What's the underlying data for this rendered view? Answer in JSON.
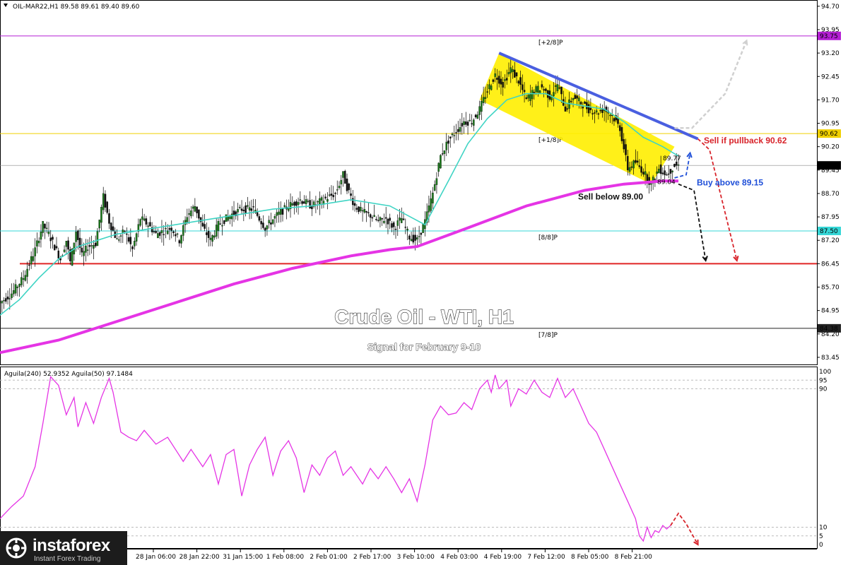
{
  "header": {
    "symbol_line": "OIL-MAR22,H1  89.58 89.61 89.40 89.60",
    "indicator_line": "Aguila(240) 52.9352  Aguila(50) 97.1484"
  },
  "overlay": {
    "title": "Crude Oil - WTI, H1",
    "subtitle": "Signal for February 9-10"
  },
  "logo": {
    "name": "instaforex",
    "tagline": "Instant Forex Trading",
    "icon": "instaforex-logo-icon"
  },
  "colors": {
    "ma200": "#e534e5",
    "ma21": "#3fd4c4",
    "channel": "#ffee00",
    "trendline": "#4a5fe0",
    "support_line": "#e02525",
    "murray_top": "#b41fd4",
    "murray_yellow": "#f0d000",
    "murray_cyan": "#35d7d7",
    "bull": "#1a7a1a",
    "bear": "#111111",
    "sell_annotation": "#d8232a",
    "buy_annotation": "#1f4fd8",
    "oscillator": "#e534e5"
  },
  "chart_data": [
    {
      "type": "candlestick",
      "title": "Crude Oil - WTI, H1",
      "x_tick_labels": [
        "28 Jan 06:00",
        "28 Jan 22:00",
        "31 Jan 15:00",
        "1 Feb 08:00",
        "2 Feb 01:00",
        "2 Feb 17:00",
        "3 Feb 10:00",
        "4 Feb 03:00",
        "4 Feb 19:00",
        "7 Feb 12:00",
        "8 Feb 05:00",
        "8 Feb 21:00"
      ],
      "y_tick_labels": [
        "94.70",
        "93.95",
        "93.20",
        "92.45",
        "91.70",
        "90.95",
        "90.20",
        "89.45",
        "88.70",
        "87.95",
        "87.20",
        "86.45",
        "85.70",
        "84.95",
        "84.20",
        "83.45"
      ],
      "ylim": [
        83.2,
        94.9
      ],
      "close_path": [
        [
          0,
          85.2
        ],
        [
          6,
          85.5
        ],
        [
          12,
          86.0
        ],
        [
          18,
          86.9
        ],
        [
          22,
          87.7
        ],
        [
          25,
          87.4
        ],
        [
          28,
          87.0
        ],
        [
          31,
          86.6
        ],
        [
          34,
          87.2
        ],
        [
          36,
          86.5
        ],
        [
          39,
          87.5
        ],
        [
          42,
          86.7
        ],
        [
          45,
          87.0
        ],
        [
          49,
          87.1
        ],
        [
          53,
          88.6
        ],
        [
          56,
          87.8
        ],
        [
          60,
          87.2
        ],
        [
          64,
          87.5
        ],
        [
          68,
          86.9
        ],
        [
          72,
          87.9
        ],
        [
          76,
          87.7
        ],
        [
          80,
          87.4
        ],
        [
          84,
          87.5
        ],
        [
          88,
          87.6
        ],
        [
          92,
          87.2
        ],
        [
          96,
          88.0
        ],
        [
          100,
          88.3
        ],
        [
          104,
          87.6
        ],
        [
          108,
          87.2
        ],
        [
          112,
          87.7
        ],
        [
          118,
          88.0
        ],
        [
          124,
          88.2
        ],
        [
          130,
          88.2
        ],
        [
          136,
          87.6
        ],
        [
          142,
          88.0
        ],
        [
          148,
          88.3
        ],
        [
          154,
          88.5
        ],
        [
          160,
          88.3
        ],
        [
          166,
          88.5
        ],
        [
          172,
          88.7
        ],
        [
          176,
          89.3
        ],
        [
          178,
          88.9
        ],
        [
          182,
          88.3
        ],
        [
          186,
          88.1
        ],
        [
          190,
          88.0
        ],
        [
          194,
          87.8
        ],
        [
          198,
          87.9
        ],
        [
          202,
          87.6
        ],
        [
          206,
          87.9
        ],
        [
          210,
          87.3
        ],
        [
          214,
          87.2
        ],
        [
          218,
          87.8
        ],
        [
          222,
          88.7
        ],
        [
          226,
          89.9
        ],
        [
          230,
          90.4
        ],
        [
          234,
          90.7
        ],
        [
          238,
          91.0
        ],
        [
          242,
          91.0
        ],
        [
          246,
          91.4
        ],
        [
          250,
          92.0
        ],
        [
          254,
          92.5
        ],
        [
          258,
          92.2
        ],
        [
          262,
          92.7
        ],
        [
          266,
          92.3
        ],
        [
          270,
          91.7
        ],
        [
          274,
          92.0
        ],
        [
          278,
          92.1
        ],
        [
          282,
          91.8
        ],
        [
          286,
          92.2
        ],
        [
          290,
          91.4
        ],
        [
          294,
          91.8
        ],
        [
          298,
          91.6
        ],
        [
          302,
          91.4
        ],
        [
          306,
          91.3
        ],
        [
          310,
          91.4
        ],
        [
          314,
          91.2
        ],
        [
          318,
          90.8
        ],
        [
          322,
          89.5
        ],
        [
          326,
          89.7
        ],
        [
          330,
          89.4
        ],
        [
          334,
          89.0
        ],
        [
          338,
          89.5
        ],
        [
          342,
          89.3
        ],
        [
          346,
          89.6
        ],
        [
          348,
          89.6
        ]
      ],
      "ma21_path": [
        [
          0,
          84.8
        ],
        [
          10,
          85.3
        ],
        [
          20,
          86.0
        ],
        [
          30,
          86.6
        ],
        [
          40,
          87.0
        ],
        [
          60,
          87.4
        ],
        [
          80,
          87.6
        ],
        [
          100,
          87.8
        ],
        [
          120,
          88.0
        ],
        [
          140,
          88.2
        ],
        [
          160,
          88.3
        ],
        [
          180,
          88.5
        ],
        [
          200,
          88.3
        ],
        [
          212,
          87.9
        ],
        [
          218,
          87.7
        ],
        [
          230,
          89.1
        ],
        [
          240,
          90.3
        ],
        [
          250,
          91.1
        ],
        [
          260,
          91.7
        ],
        [
          270,
          91.9
        ],
        [
          280,
          91.9
        ],
        [
          290,
          91.6
        ],
        [
          300,
          91.5
        ],
        [
          310,
          91.4
        ],
        [
          320,
          91.0
        ],
        [
          330,
          90.5
        ],
        [
          340,
          90.2
        ],
        [
          348,
          89.9
        ]
      ],
      "ma200_path": [
        [
          0,
          83.6
        ],
        [
          30,
          84.0
        ],
        [
          60,
          84.6
        ],
        [
          90,
          85.2
        ],
        [
          120,
          85.8
        ],
        [
          150,
          86.3
        ],
        [
          180,
          86.7
        ],
        [
          200,
          86.9
        ],
        [
          214,
          87.0
        ],
        [
          240,
          87.6
        ],
        [
          270,
          88.3
        ],
        [
          300,
          88.8
        ],
        [
          320,
          89.0
        ],
        [
          340,
          89.1
        ],
        [
          348,
          89.1
        ]
      ],
      "horizontal_lines": [
        {
          "label": "[+2/8]P",
          "price": 93.75,
          "axis_label": "93.75"
        },
        {
          "label": "[+1/8]P",
          "price": 90.62,
          "axis_label": "90.62"
        },
        {
          "label": "[8/8]P",
          "price": 87.5,
          "axis_label": "87.50"
        },
        {
          "label": "[7/8]P",
          "price": 84.38,
          "axis_label": "84.38"
        },
        {
          "label": "",
          "price": 86.45,
          "axis_label": ""
        }
      ],
      "current_price": {
        "price": 89.6,
        "axis_label": "89.60"
      },
      "channel": {
        "upper": [
          [
            256,
            93.2
          ],
          [
            346,
            90.2
          ]
        ],
        "lower": [
          [
            246,
            91.7
          ],
          [
            334,
            89.0
          ]
        ]
      },
      "trendline": [
        [
          256,
          93.2
        ],
        [
          358,
          90.45
        ]
      ],
      "annotations": [
        {
          "text": "Sell if pullback 90.62",
          "price": 90.4,
          "role": "sell"
        },
        {
          "text": "Buy above 89.15",
          "price": 89.05,
          "role": "buy"
        },
        {
          "text": "Sell below 89.00",
          "price": 88.6,
          "role": "sell-below"
        },
        {
          "text": "89.77",
          "price": 89.85,
          "role": "level"
        },
        {
          "text": "89.04",
          "price": 89.1,
          "role": "level"
        }
      ],
      "projections": [
        {
          "role": "bullish",
          "color": "#d0d0d0",
          "points": [
            [
              346,
              90.8
            ],
            [
              355,
              90.8
            ],
            [
              372,
              91.9
            ],
            [
              383,
              93.6
            ]
          ]
        },
        {
          "role": "bearish-red",
          "color": "#d8232a",
          "points": [
            [
              358,
              90.45
            ],
            [
              364,
              90.1
            ],
            [
              378,
              86.55
            ]
          ]
        },
        {
          "role": "bearish-black",
          "color": "#111111",
          "points": [
            [
              348,
              89.0
            ],
            [
              356,
              88.8
            ],
            [
              362,
              86.55
            ]
          ]
        },
        {
          "role": "buy-up",
          "color": "#1f4fd8",
          "points": [
            [
              346,
              89.2
            ],
            [
              352,
              89.3
            ],
            [
              354,
              90.0
            ]
          ]
        }
      ]
    },
    {
      "type": "line",
      "title": "Aguila(240) 52.9352  Aguila(50) 97.1484",
      "ylim": [
        0,
        100
      ],
      "y_tick_labels": [
        "100",
        "95",
        "90",
        "10",
        "5",
        "0"
      ],
      "levels": [
        95,
        90,
        10,
        5
      ],
      "series": [
        {
          "name": "",
          "points": [
            [
              0,
              15
            ],
            [
              6,
              22
            ],
            [
              12,
              28
            ],
            [
              18,
              45
            ],
            [
              22,
              70
            ],
            [
              26,
              97
            ],
            [
              30,
              92
            ],
            [
              34,
              75
            ],
            [
              38,
              85
            ],
            [
              40,
              68
            ],
            [
              44,
              82
            ],
            [
              48,
              70
            ],
            [
              52,
              85
            ],
            [
              56,
              96
            ],
            [
              58,
              88
            ],
            [
              62,
              65
            ],
            [
              66,
              62
            ],
            [
              70,
              60
            ],
            [
              74,
              66
            ],
            [
              80,
              58
            ],
            [
              86,
              62
            ],
            [
              90,
              55
            ],
            [
              94,
              48
            ],
            [
              98,
              55
            ],
            [
              104,
              45
            ],
            [
              108,
              52
            ],
            [
              112,
              35
            ],
            [
              116,
              52
            ],
            [
              120,
              55
            ],
            [
              124,
              28
            ],
            [
              128,
              46
            ],
            [
              132,
              55
            ],
            [
              136,
              62
            ],
            [
              140,
              40
            ],
            [
              144,
              54
            ],
            [
              148,
              60
            ],
            [
              152,
              50
            ],
            [
              156,
              30
            ],
            [
              160,
              46
            ],
            [
              164,
              40
            ],
            [
              168,
              50
            ],
            [
              172,
              54
            ],
            [
              176,
              40
            ],
            [
              180,
              45
            ],
            [
              186,
              35
            ],
            [
              190,
              44
            ],
            [
              194,
              38
            ],
            [
              198,
              45
            ],
            [
              202,
              38
            ],
            [
              206,
              30
            ],
            [
              210,
              38
            ],
            [
              214,
              25
            ],
            [
              218,
              46
            ],
            [
              222,
              72
            ],
            [
              226,
              80
            ],
            [
              230,
              75
            ],
            [
              234,
              76
            ],
            [
              238,
              82
            ],
            [
              242,
              78
            ],
            [
              246,
              90
            ],
            [
              250,
              95
            ],
            [
              252,
              88
            ],
            [
              254,
              98
            ],
            [
              256,
              90
            ],
            [
              260,
              95
            ],
            [
              262,
              80
            ],
            [
              266,
              90
            ],
            [
              270,
              87
            ],
            [
              274,
              95
            ],
            [
              278,
              88
            ],
            [
              282,
              85
            ],
            [
              286,
              96
            ],
            [
              290,
              85
            ],
            [
              294,
              90
            ],
            [
              298,
              80
            ],
            [
              302,
              70
            ],
            [
              306,
              65
            ],
            [
              310,
              55
            ],
            [
              314,
              45
            ],
            [
              318,
              35
            ],
            [
              322,
              25
            ],
            [
              326,
              15
            ],
            [
              328,
              5
            ],
            [
              330,
              2
            ],
            [
              332,
              10
            ],
            [
              334,
              4
            ],
            [
              336,
              8
            ],
            [
              338,
              7
            ],
            [
              340,
              11
            ],
            [
              342,
              9
            ],
            [
              344,
              11
            ]
          ]
        },
        {
          "name": "",
          "color": "#d8232a",
          "dashed": true,
          "points": [
            [
              344,
              11
            ],
            [
              348,
              18
            ],
            [
              352,
              12
            ],
            [
              358,
              0
            ]
          ]
        }
      ]
    }
  ]
}
